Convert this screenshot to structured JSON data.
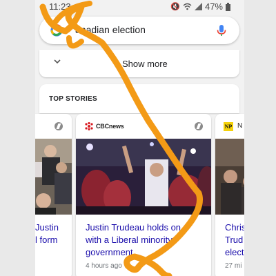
{
  "status_bar": {
    "time": "11:23",
    "battery": "47%"
  },
  "search": {
    "query": "canadian election",
    "visible_query": "anadian election"
  },
  "show_more": {
    "label": "Show more"
  },
  "top_stories": {
    "label": "TOP STORIES",
    "cards": [
      {
        "source": "",
        "headline_lines": [
          "Justin",
          "l form"
        ],
        "time": ""
      },
      {
        "source": "CBCnews",
        "headline_lines": [
          "Justin Trudeau holds on",
          "with a Liberal minority",
          "government"
        ],
        "time": "4 hours ago"
      },
      {
        "source": "NP",
        "source_tail": "N",
        "headline_lines": [
          "Chris",
          "Trud",
          "elect"
        ],
        "time": "27 mi"
      }
    ]
  },
  "icons": [
    "google-logo",
    "microphone",
    "chevron-down",
    "amp-badge",
    "cbc-gem-logo",
    "national-post-logo",
    "mute",
    "wifi",
    "signal",
    "battery"
  ],
  "colors": {
    "annotation_stroke": "#f39a16",
    "headline": "#1a0dab",
    "cbc_red": "#d71920",
    "np_yellow": "#f5d20a"
  }
}
